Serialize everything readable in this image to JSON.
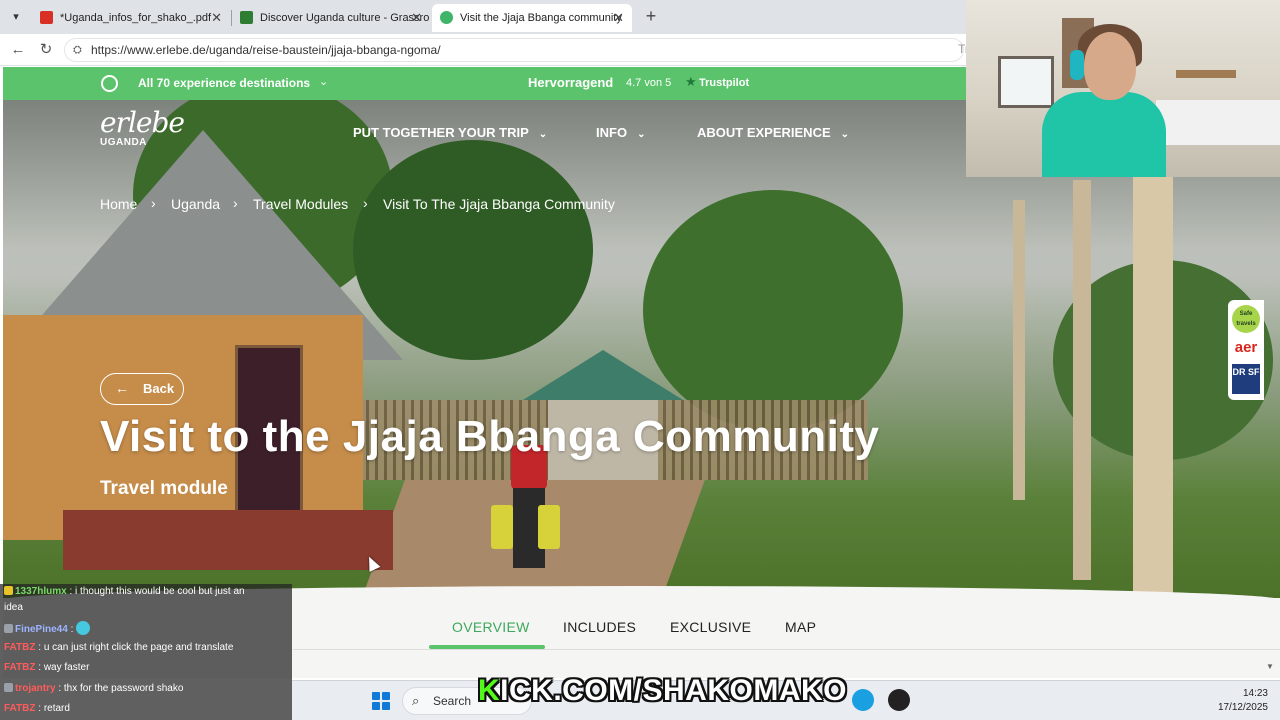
{
  "browser": {
    "tabs": [
      {
        "title": "*Uganda_infos_for_shako_.pdf",
        "icon": "pdf-icon",
        "color": "#d93025"
      },
      {
        "title": "Discover Uganda culture - Grassro",
        "icon": "site-icon",
        "color": "#2e7d32"
      },
      {
        "title": "Visit the Jjaja Bbanga community",
        "icon": "heart-icon",
        "color": "#3fb56a"
      }
    ],
    "url": "https://www.erlebe.de/uganda/reise-baustein/jjaja-bbanga-ngoma/",
    "url_right_fragment": "Tr"
  },
  "promo": {
    "destinations": "All 70 experience destinations",
    "rating_word": "Hervorragend",
    "rating_score": "4.7 von 5",
    "rating_provider": "Trustpilot"
  },
  "site": {
    "logo": "erlebe",
    "logo_sub": "UGANDA",
    "nav": [
      "PUT TOGETHER YOUR TRIP",
      "INFO",
      "ABOUT EXPERIENCE"
    ],
    "breadcrumb": [
      "Home",
      "Uganda",
      "Travel Modules",
      "Visit To The Jjaja Bbanga Community"
    ],
    "back_label": "Back",
    "title": "Visit to the Jjaja Bbanga Community",
    "subtitle": "Travel module",
    "badges": {
      "safe": "Safe travels",
      "aer": "aer",
      "drsf": "DR SF"
    },
    "tabs": [
      "OVERVIEW",
      "INCLUDES",
      "EXCLUSIVE",
      "MAP"
    ],
    "active_tab": "OVERVIEW",
    "accent": "#5cc36d"
  },
  "chat": [
    {
      "user": "1337hlumx",
      "msg": ": i thought this would be cool but just an",
      "user_color": "#7bd96a"
    },
    {
      "user": "",
      "msg": "idea",
      "user_color": "#ffffff"
    },
    {
      "user": "FinePine44",
      "msg": ":",
      "user_color": "#9db4ff"
    },
    {
      "user": "FATBZ",
      "msg": ": u can just right click the page and translate",
      "user_color": "#ff5b5b"
    },
    {
      "user": "FATBZ",
      "msg": ": way faster",
      "user_color": "#ff5b5b"
    },
    {
      "user": "trojantry",
      "msg": ": thx for the password shako",
      "user_color": "#ff5b5b"
    },
    {
      "user": "FATBZ",
      "msg": ": retard",
      "user_color": "#ff5b5b"
    }
  ],
  "overlay": {
    "kick_k": "K",
    "kick_rest": "ICK.COM/SHAKOMAKO"
  },
  "taskbar": {
    "search_label": "Search",
    "time": "14:23",
    "date": "17/12/2025"
  }
}
